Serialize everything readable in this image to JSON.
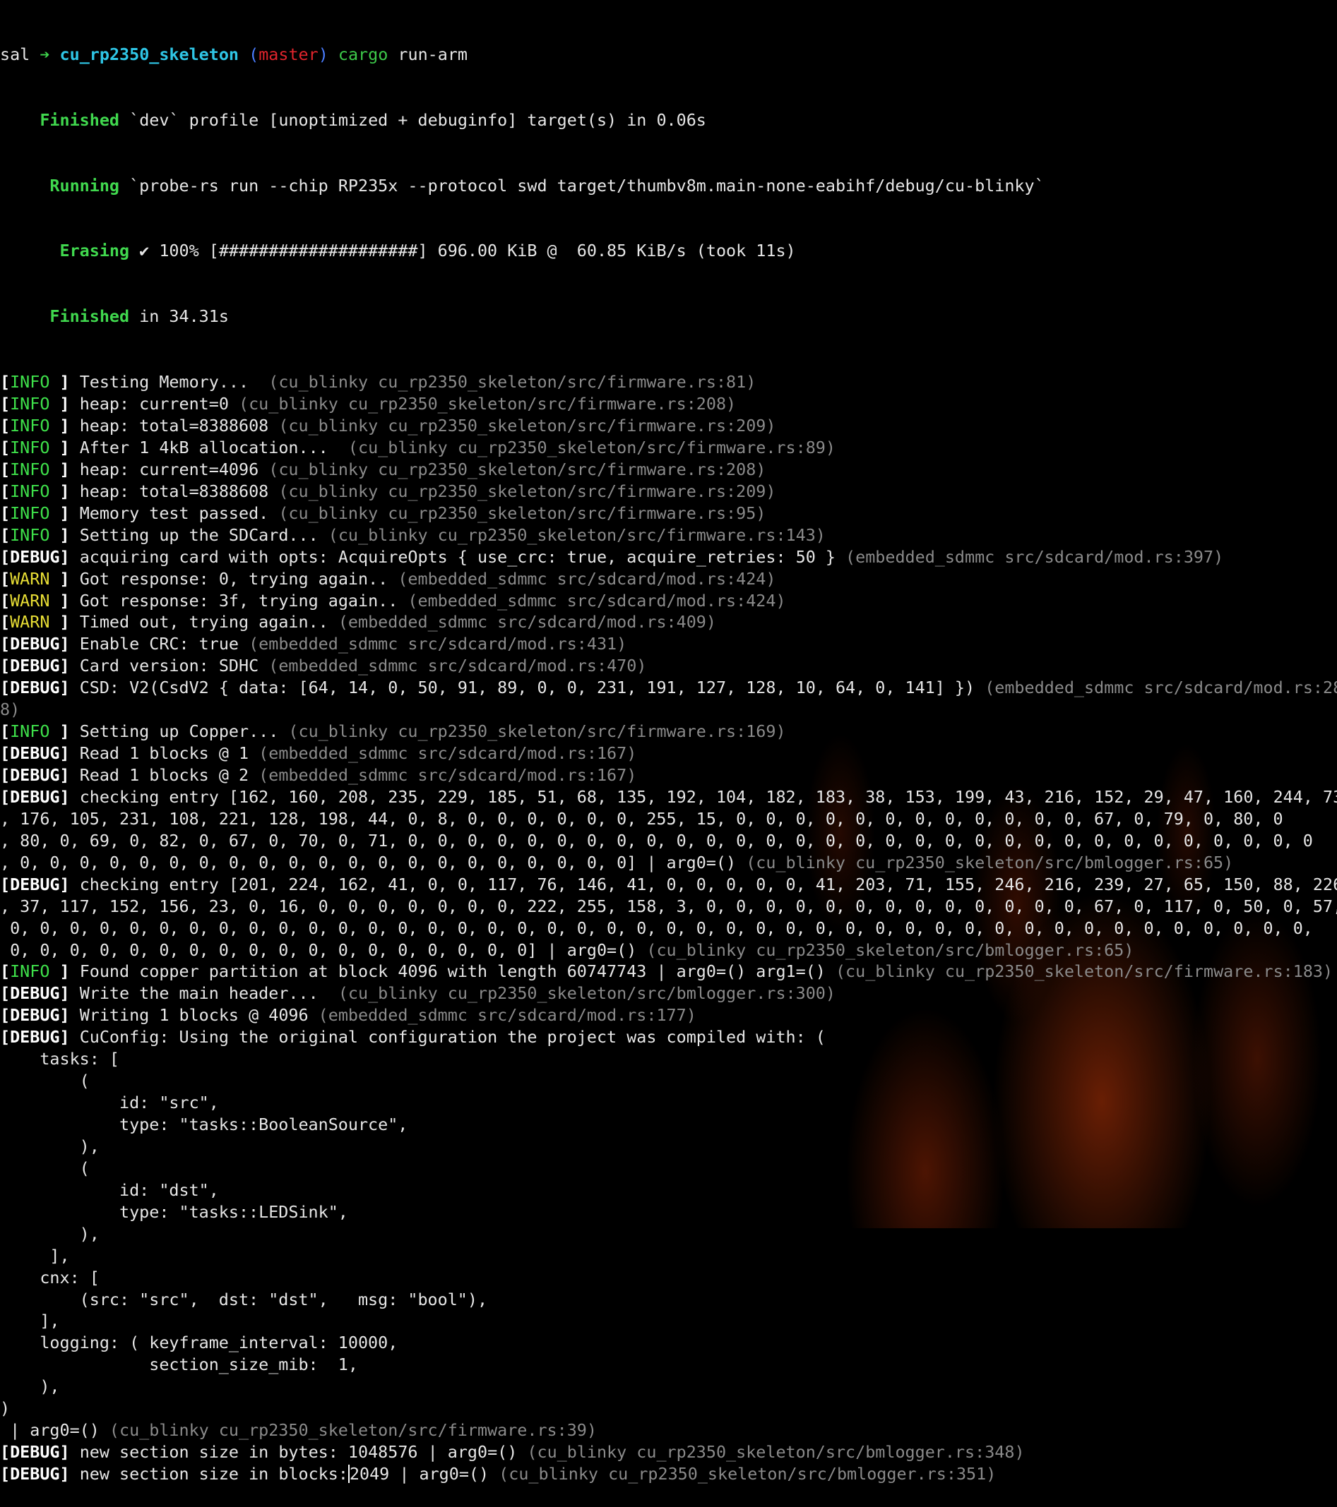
{
  "prompt": {
    "user": "sal",
    "arrow": "➔",
    "dir": "cu_rp2350_skeleton",
    "branch": "master",
    "command": "cargo",
    "args": "run-arm"
  },
  "cargo": {
    "finished_label": "Finished",
    "finished_text": "`dev` profile [unoptimized + debuginfo] target(s) in 0.06s",
    "running_label": "Running",
    "running_text": "`probe-rs run --chip RP235x --protocol swd target/thumbv8m.main-none-eabihf/debug/cu-blinky`",
    "erasing_label": "Erasing",
    "erasing_text": "✔ 100% [####################] 696.00 KiB @  60.85 KiB/s (took 11s)",
    "finished2_label": "Finished",
    "finished2_text": "in 34.31s"
  },
  "tags": {
    "info": "INFO ",
    "warn": "WARN ",
    "debug": "DEBUG"
  },
  "logs": [
    {
      "level": "info",
      "msg": "Testing Memory...  ",
      "src": "(cu_blinky cu_rp2350_skeleton/src/firmware.rs:81)"
    },
    {
      "level": "info",
      "msg": "heap: current=0 ",
      "src": "(cu_blinky cu_rp2350_skeleton/src/firmware.rs:208)"
    },
    {
      "level": "info",
      "msg": "heap: total=8388608 ",
      "src": "(cu_blinky cu_rp2350_skeleton/src/firmware.rs:209)"
    },
    {
      "level": "info",
      "msg": "After 1 4kB allocation...  ",
      "src": "(cu_blinky cu_rp2350_skeleton/src/firmware.rs:89)"
    },
    {
      "level": "info",
      "msg": "heap: current=4096 ",
      "src": "(cu_blinky cu_rp2350_skeleton/src/firmware.rs:208)"
    },
    {
      "level": "info",
      "msg": "heap: total=8388608 ",
      "src": "(cu_blinky cu_rp2350_skeleton/src/firmware.rs:209)"
    },
    {
      "level": "info",
      "msg": "Memory test passed. ",
      "src": "(cu_blinky cu_rp2350_skeleton/src/firmware.rs:95)"
    },
    {
      "level": "info",
      "msg": "Setting up the SDCard... ",
      "src": "(cu_blinky cu_rp2350_skeleton/src/firmware.rs:143)"
    },
    {
      "level": "debug",
      "msg": "acquiring card with opts: AcquireOpts { use_crc: true, acquire_retries: 50 } ",
      "src": "(embedded_sdmmc src/sdcard/mod.rs:397)"
    },
    {
      "level": "warn",
      "msg": "Got response: 0, trying again.. ",
      "src": "(embedded_sdmmc src/sdcard/mod.rs:424)"
    },
    {
      "level": "warn",
      "msg": "Got response: 3f, trying again.. ",
      "src": "(embedded_sdmmc src/sdcard/mod.rs:424)"
    },
    {
      "level": "warn",
      "msg": "Timed out, trying again.. ",
      "src": "(embedded_sdmmc src/sdcard/mod.rs:409)"
    },
    {
      "level": "debug",
      "msg": "Enable CRC: true ",
      "src": "(embedded_sdmmc src/sdcard/mod.rs:431)"
    },
    {
      "level": "debug",
      "msg": "Card version: SDHC ",
      "src": "(embedded_sdmmc src/sdcard/mod.rs:470)"
    },
    {
      "level": "debug",
      "msg": "CSD: V2(CsdV2 { data: [64, 14, 0, 50, 91, 89, 0, 0, 231, 191, 127, 128, 10, 64, 0, 141] }) ",
      "src": "(embedded_sdmmc src/sdcard/mod.rs:28"
    },
    {
      "level": "cont",
      "msg": "",
      "src": "8)"
    },
    {
      "level": "info",
      "msg": "Setting up Copper... ",
      "src": "(cu_blinky cu_rp2350_skeleton/src/firmware.rs:169)"
    },
    {
      "level": "debug",
      "msg": "Read 1 blocks @ 1 ",
      "src": "(embedded_sdmmc src/sdcard/mod.rs:167)"
    },
    {
      "level": "debug",
      "msg": "Read 1 blocks @ 2 ",
      "src": "(embedded_sdmmc src/sdcard/mod.rs:167)"
    },
    {
      "level": "debug",
      "msg": "checking entry [162, 160, 208, 235, 229, 185, 51, 68, 135, 192, 104, 182, 183, 38, 153, 199, 43, 216, 152, 29, 47, 160, 244, 73",
      "src": ""
    },
    {
      "level": "cont",
      "msg": ", 176, 105, 231, 108, 221, 128, 198, 44, 0, 8, 0, 0, 0, 0, 0, 0, 255, 15, 0, 0, 0, 0, 0, 0, 0, 0, 0, 0, 0, 0, 67, 0, 79, 0, 80, 0",
      "src": ""
    },
    {
      "level": "cont",
      "msg": ", 80, 0, 69, 0, 82, 0, 67, 0, 70, 0, 71, 0, 0, 0, 0, 0, 0, 0, 0, 0, 0, 0, 0, 0, 0, 0, 0, 0, 0, 0, 0, 0, 0, 0, 0, 0, 0, 0, 0, 0, 0, 0",
      "src": ""
    },
    {
      "level": "cont",
      "msg": ", 0, 0, 0, 0, 0, 0, 0, 0, 0, 0, 0, 0, 0, 0, 0, 0, 0, 0, 0, 0, 0] | arg0=() ",
      "src": "(cu_blinky cu_rp2350_skeleton/src/bmlogger.rs:65)"
    },
    {
      "level": "debug",
      "msg": "checking entry [201, 224, 162, 41, 0, 0, 117, 76, 146, 41, 0, 0, 0, 0, 0, 41, 203, 71, 155, 246, 216, 239, 27, 65, 150, 88, 226",
      "src": ""
    },
    {
      "level": "cont",
      "msg": ", 37, 117, 152, 156, 23, 0, 16, 0, 0, 0, 0, 0, 0, 0, 222, 255, 158, 3, 0, 0, 0, 0, 0, 0, 0, 0, 0, 0, 0, 0, 0, 67, 0, 117, 0, 50, 0, 57, 0, 0,",
      "src": ""
    },
    {
      "level": "cont",
      "msg": " 0, 0, 0, 0, 0, 0, 0, 0, 0, 0, 0, 0, 0, 0, 0, 0, 0, 0, 0, 0, 0, 0, 0, 0, 0, 0, 0, 0, 0, 0, 0, 0, 0, 0, 0, 0, 0, 0, 0, 0, 0, 0, 0, 0,",
      "src": ""
    },
    {
      "level": "cont",
      "msg": " 0, 0, 0, 0, 0, 0, 0, 0, 0, 0, 0, 0, 0, 0, 0, 0, 0, 0] | arg0=() ",
      "src": "(cu_blinky cu_rp2350_skeleton/src/bmlogger.rs:65)"
    },
    {
      "level": "info",
      "msg": "Found copper partition at block 4096 with length 60747743 | arg0=() arg1=() ",
      "src": "(cu_blinky cu_rp2350_skeleton/src/firmware.rs:183)"
    },
    {
      "level": "debug",
      "msg": "Write the main header...  ",
      "src": "(cu_blinky cu_rp2350_skeleton/src/bmlogger.rs:300)"
    },
    {
      "level": "debug",
      "msg": "Writing 1 blocks @ 4096 ",
      "src": "(embedded_sdmmc src/sdcard/mod.rs:177)"
    },
    {
      "level": "debug",
      "msg": "CuConfig: Using the original configuration the project was compiled with: (",
      "src": ""
    },
    {
      "level": "cont",
      "msg": "    tasks: [",
      "src": ""
    },
    {
      "level": "cont",
      "msg": "        (",
      "src": ""
    },
    {
      "level": "cont",
      "msg": "            id: \"src\",",
      "src": ""
    },
    {
      "level": "cont",
      "msg": "            type: \"tasks::BooleanSource\",",
      "src": ""
    },
    {
      "level": "cont",
      "msg": "        ),",
      "src": ""
    },
    {
      "level": "cont",
      "msg": "        (",
      "src": ""
    },
    {
      "level": "cont",
      "msg": "            id: \"dst\",",
      "src": ""
    },
    {
      "level": "cont",
      "msg": "            type: \"tasks::LEDSink\",",
      "src": ""
    },
    {
      "level": "cont",
      "msg": "        ),",
      "src": ""
    },
    {
      "level": "cont",
      "msg": "     ],",
      "src": ""
    },
    {
      "level": "cont",
      "msg": "    cnx: [",
      "src": ""
    },
    {
      "level": "cont",
      "msg": "        (src: \"src\",  dst: \"dst\",   msg: \"bool\"),",
      "src": ""
    },
    {
      "level": "cont",
      "msg": "    ],",
      "src": ""
    },
    {
      "level": "cont",
      "msg": "    logging: ( keyframe_interval: 10000,",
      "src": ""
    },
    {
      "level": "cont",
      "msg": "               section_size_mib:  1,",
      "src": ""
    },
    {
      "level": "cont",
      "msg": "    ),",
      "src": ""
    },
    {
      "level": "cont",
      "msg": ")",
      "src": ""
    },
    {
      "level": "cont",
      "msg": " | arg0=() ",
      "src": "(cu_blinky cu_rp2350_skeleton/src/firmware.rs:39)"
    },
    {
      "level": "debug",
      "msg": "new section size in bytes: 1048576 | arg0=() ",
      "src": "(cu_blinky cu_rp2350_skeleton/src/bmlogger.rs:348)"
    },
    {
      "level": "debug",
      "msg": "new section size in blocks:",
      "cursor": true,
      "msg2": "2049 | arg0=() ",
      "src": "(cu_blinky cu_rp2350_skeleton/src/bmlogger.rs:351)"
    }
  ],
  "colors": {
    "background": "#000000",
    "text": "#e6e6e6",
    "info": "#3ee04a",
    "warn": "#e8de35",
    "dim": "#8a8a8a",
    "dir": "#2fc6e6",
    "branch": "#e0242c"
  }
}
